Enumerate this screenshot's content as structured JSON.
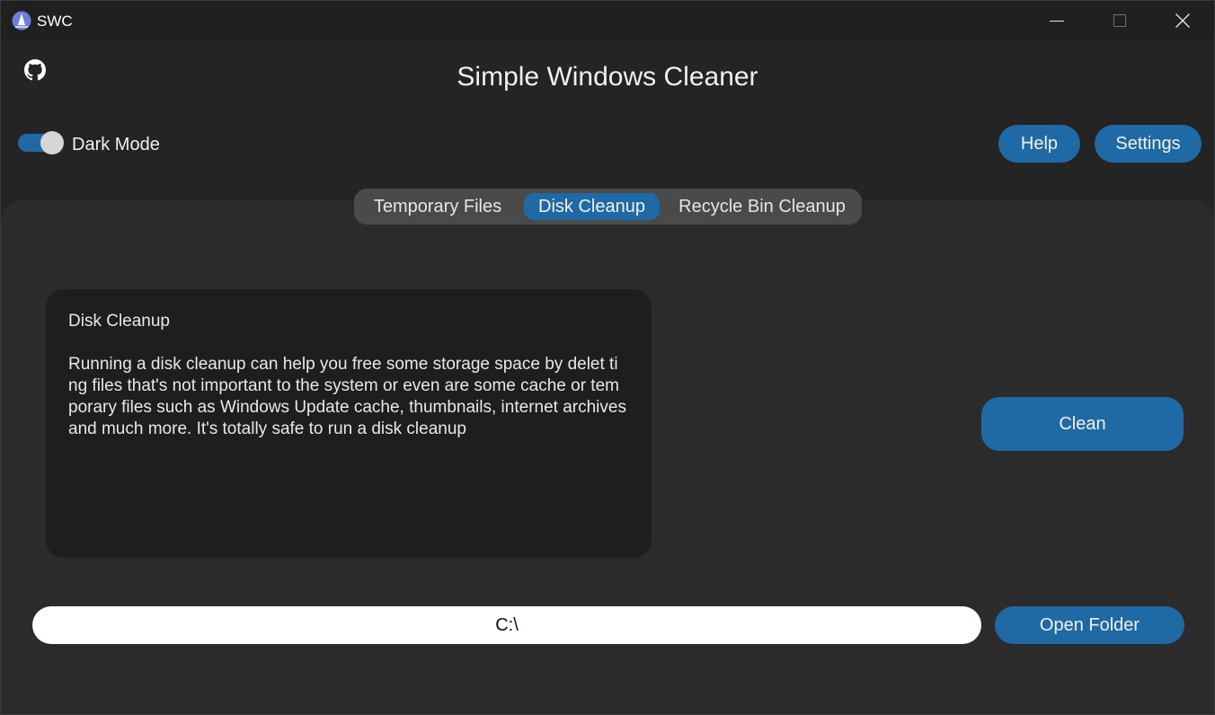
{
  "window": {
    "title": "SWC"
  },
  "header": {
    "app_title": "Simple Windows Cleaner",
    "dark_mode_label": "Dark Mode",
    "dark_mode_on": true,
    "help_label": "Help",
    "settings_label": "Settings"
  },
  "tabs": [
    {
      "label": "Temporary Files",
      "selected": false
    },
    {
      "label": "Disk Cleanup",
      "selected": true
    },
    {
      "label": "Recycle Bin Cleanup",
      "selected": false
    }
  ],
  "info": {
    "heading": "Disk Cleanup",
    "body": "Running a disk cleanup can help you free some storage space by delet ting files that's not important to the system or even are some cache or temporary files such as Windows Update cache, thumbnails, internet archives and much more. It's totally safe to run a disk cleanup"
  },
  "actions": {
    "clean_label": "Clean",
    "path_value": "C:\\",
    "open_folder_label": "Open Folder"
  },
  "colors": {
    "accent": "#1f6aa5",
    "background": "#242424",
    "panel": "#2b2b2b",
    "info_box": "#1d1e1e",
    "tab_bar": "#4a4a4a"
  },
  "icons": {
    "app": "app-logo-icon",
    "github": "github-icon",
    "minimize": "minimize-icon",
    "maximize": "maximize-icon",
    "close": "close-icon"
  }
}
